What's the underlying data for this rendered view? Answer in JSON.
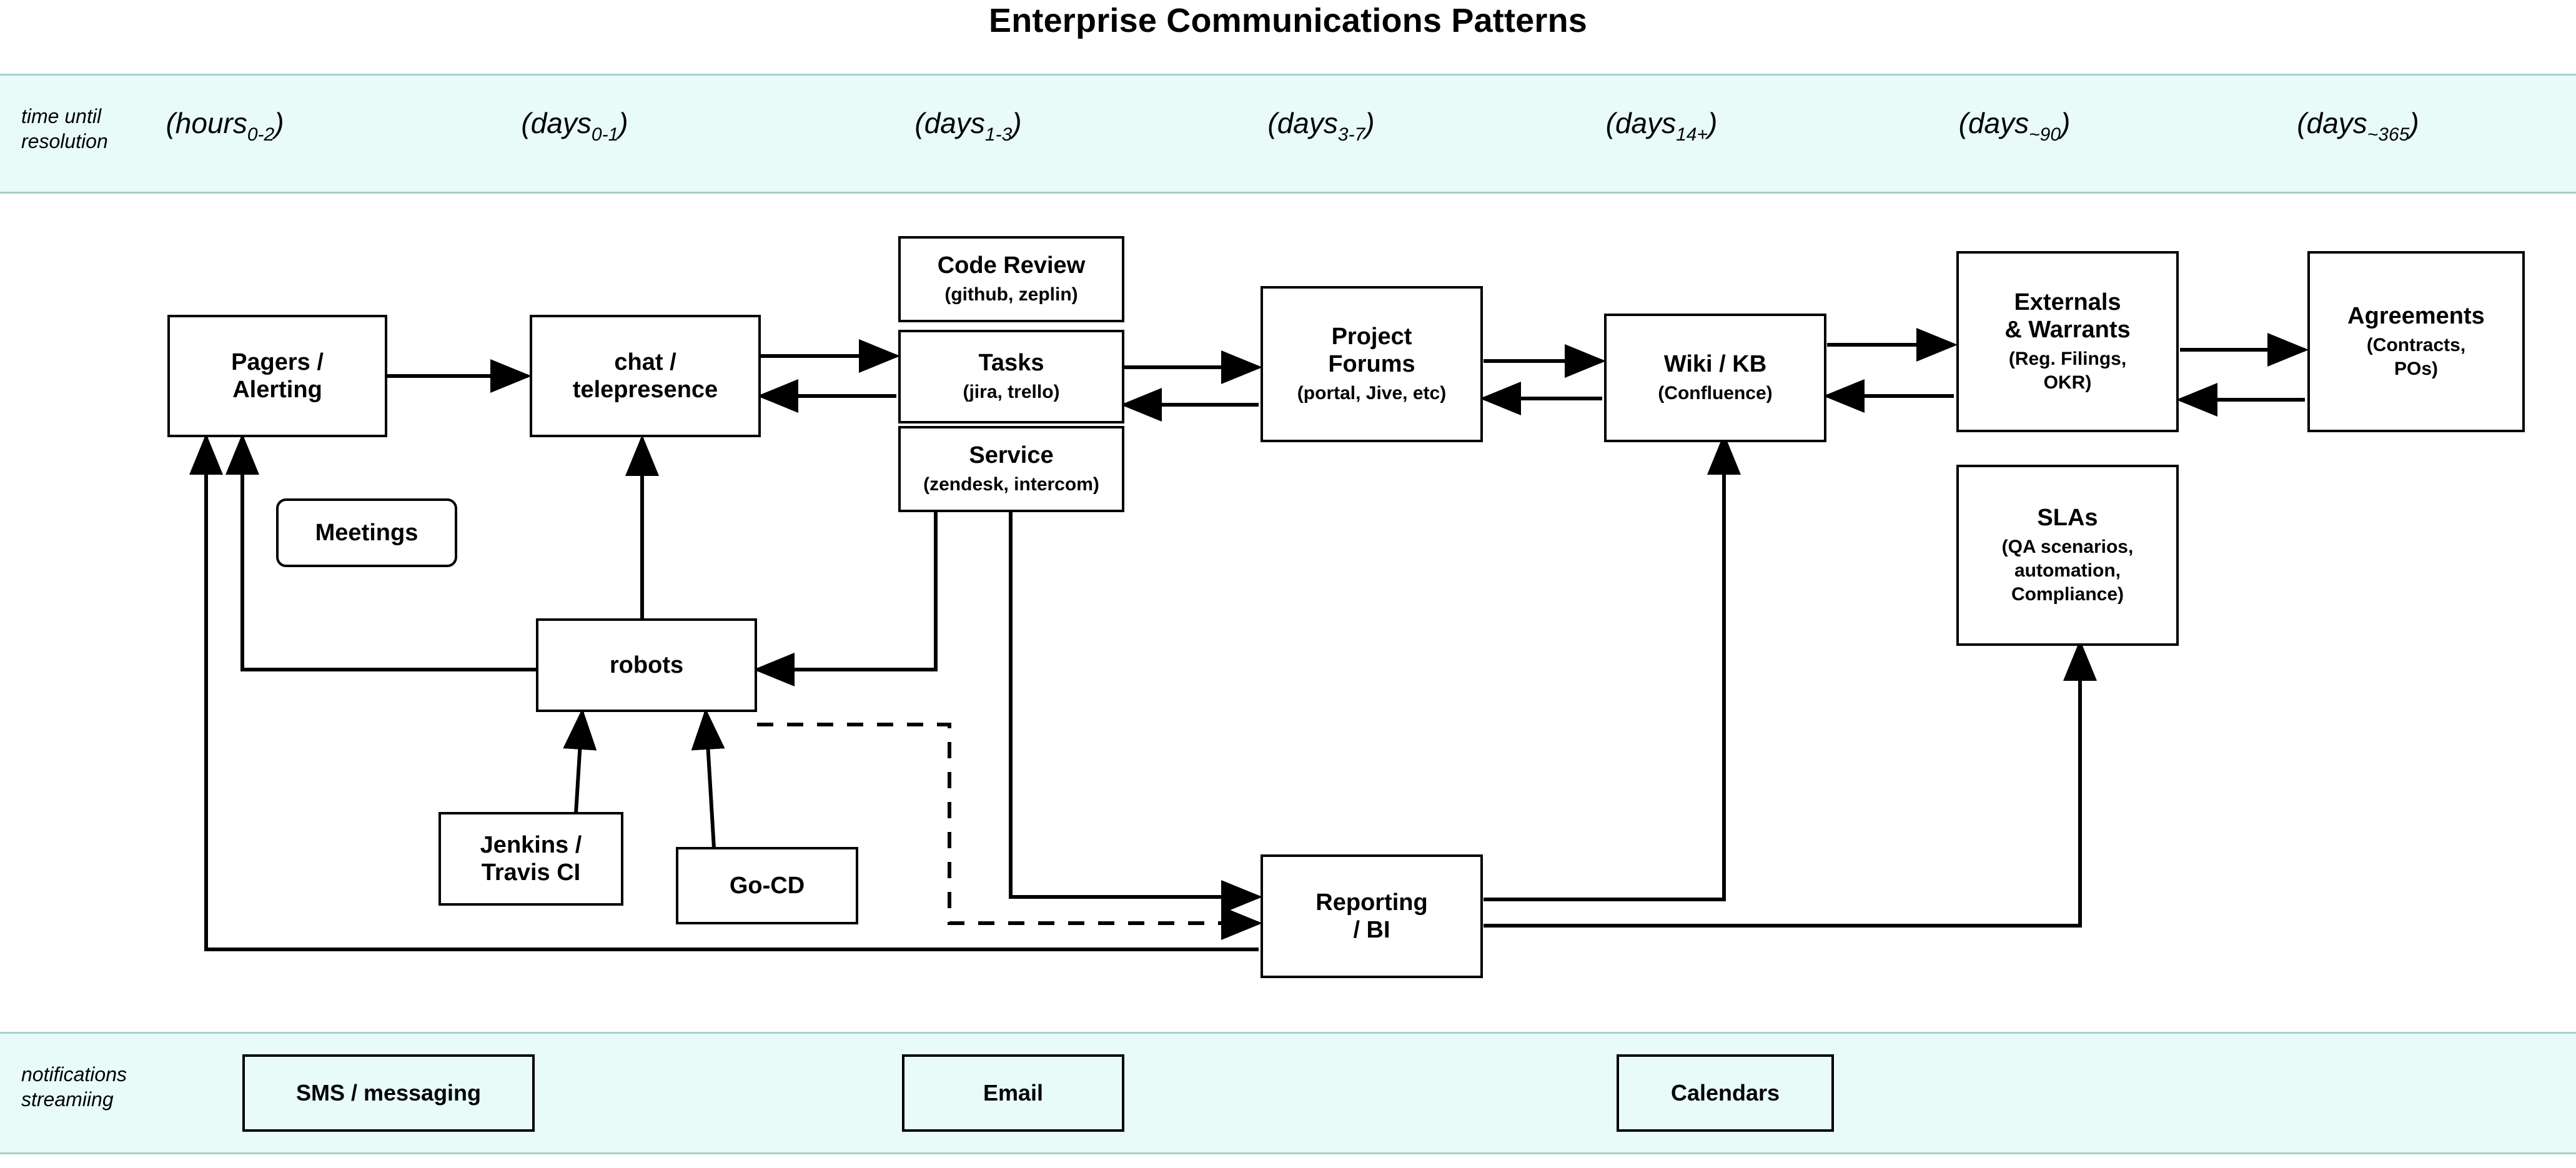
{
  "title": "Enterprise Communications Patterns",
  "theme": {
    "band_fill": "#e8fbf8",
    "band_border": "#a8cfcb",
    "node_border": "#000000",
    "node_fill": "#ffffff",
    "text": "#000000"
  },
  "time_band": {
    "label": "time until\nresolution",
    "ticks": [
      {
        "id": "t1",
        "prefix": "(hours",
        "sub": "0-2",
        "suffix": ")"
      },
      {
        "id": "t2",
        "prefix": "(days",
        "sub": "0-1",
        "suffix": ")"
      },
      {
        "id": "t3",
        "prefix": "(days",
        "sub": "1-3",
        "suffix": ")"
      },
      {
        "id": "t4",
        "prefix": "(days",
        "sub": "3-7",
        "suffix": ")"
      },
      {
        "id": "t5",
        "prefix": "(days",
        "sub": "14+",
        "suffix": ")"
      },
      {
        "id": "t6",
        "prefix": "(days",
        "sub": "~90",
        "suffix": ")"
      },
      {
        "id": "t7",
        "prefix": "(days",
        "sub": "~365",
        "suffix": ")"
      }
    ]
  },
  "notify_band": {
    "label": "notifications\nstreamiing",
    "channels": [
      {
        "id": "sms",
        "label": "SMS / messaging"
      },
      {
        "id": "email",
        "label": "Email"
      },
      {
        "id": "calendars",
        "label": "Calendars"
      }
    ]
  },
  "nodes": {
    "pagers": {
      "title": "Pagers /\nAlerting",
      "sub": ""
    },
    "chat": {
      "title": "chat /\ntelepresence",
      "sub": ""
    },
    "meetings": {
      "title": "Meetings",
      "sub": ""
    },
    "code_review": {
      "title": "Code Review",
      "sub": "(github, zeplin)"
    },
    "tasks": {
      "title": "Tasks",
      "sub": "(jira, trello)"
    },
    "service": {
      "title": "Service",
      "sub": "(zendesk, intercom)"
    },
    "project_forums": {
      "title": "Project\nForums",
      "sub": "(portal, Jive, etc)"
    },
    "wiki": {
      "title": "Wiki / KB",
      "sub": "(Confluence)"
    },
    "externals": {
      "title": "Externals\n& Warrants",
      "sub": "(Reg. Filings,\nOKR)"
    },
    "agreements": {
      "title": "Agreements",
      "sub": "(Contracts,\nPOs)"
    },
    "slas": {
      "title": "SLAs",
      "sub": "(QA scenarios,\nautomation,\nCompliance)"
    },
    "robots": {
      "title": "robots",
      "sub": ""
    },
    "jenkins": {
      "title": "Jenkins /\nTravis CI",
      "sub": ""
    },
    "gocd": {
      "title": "Go-CD",
      "sub": ""
    },
    "reporting": {
      "title": "Reporting\n/ BI",
      "sub": ""
    }
  },
  "edges": [
    {
      "from": "pagers",
      "to": "chat",
      "style": "solid",
      "arrow": "single"
    },
    {
      "from": "chat",
      "to": "tasks",
      "style": "solid",
      "arrow": "double"
    },
    {
      "from": "tasks",
      "to": "project_forums",
      "style": "solid",
      "arrow": "double"
    },
    {
      "from": "project_forums",
      "to": "wiki",
      "style": "solid",
      "arrow": "double"
    },
    {
      "from": "wiki",
      "to": "externals",
      "style": "solid",
      "arrow": "double"
    },
    {
      "from": "externals",
      "to": "agreements",
      "style": "solid",
      "arrow": "double"
    },
    {
      "from": "robots",
      "to": "chat",
      "style": "solid",
      "arrow": "single"
    },
    {
      "from": "robots",
      "to": "pagers",
      "style": "solid",
      "arrow": "single"
    },
    {
      "from": "service",
      "to": "robots",
      "style": "solid",
      "arrow": "single"
    },
    {
      "from": "jenkins",
      "to": "robots",
      "style": "solid",
      "arrow": "single"
    },
    {
      "from": "gocd",
      "to": "robots",
      "style": "solid",
      "arrow": "single"
    },
    {
      "from": "robots",
      "to": "reporting",
      "style": "dashed",
      "arrow": "single"
    },
    {
      "from": "service",
      "to": "reporting",
      "style": "solid",
      "arrow": "single"
    },
    {
      "from": "reporting",
      "to": "pagers",
      "style": "solid",
      "arrow": "single"
    },
    {
      "from": "reporting",
      "to": "wiki",
      "style": "solid",
      "arrow": "single"
    },
    {
      "from": "reporting",
      "to": "slas",
      "style": "solid",
      "arrow": "single"
    }
  ]
}
